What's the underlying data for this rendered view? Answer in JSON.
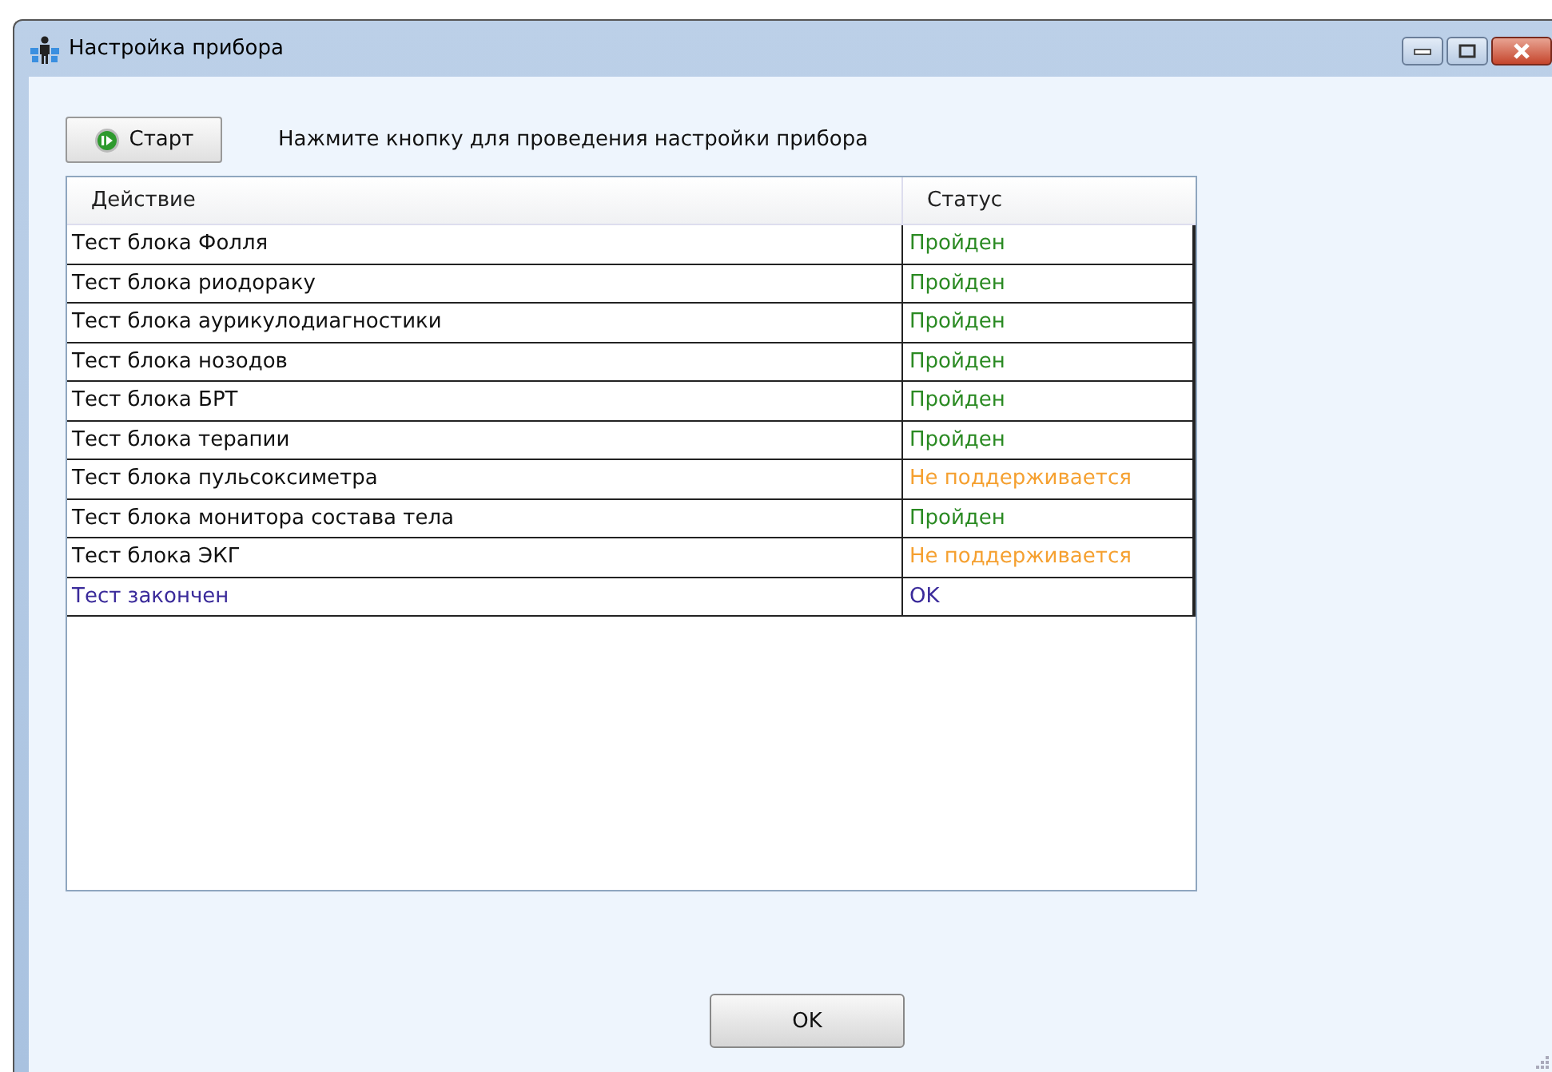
{
  "window": {
    "title": "Настройка прибора"
  },
  "start_button": {
    "label": "Старт"
  },
  "hint": "Нажмите кнопку для проведения настройки прибора",
  "table": {
    "columns": [
      "Действие",
      "Статус"
    ],
    "rows": [
      {
        "kind": "passed",
        "action": "Тест блока Фолля",
        "status": "Пройден"
      },
      {
        "kind": "passed",
        "action": "Тест блока риодораку",
        "status": "Пройден"
      },
      {
        "kind": "passed",
        "action": "Тест блока аурикулодиагностики",
        "status": "Пройден"
      },
      {
        "kind": "passed",
        "action": "Тест блока нозодов",
        "status": "Пройден"
      },
      {
        "kind": "passed",
        "action": "Тест блока БРТ",
        "status": "Пройден"
      },
      {
        "kind": "passed",
        "action": "Тест блока терапии",
        "status": "Пройден"
      },
      {
        "kind": "unsupported",
        "action": "Тест блока пульсоксиметра",
        "status": "Не поддерживается"
      },
      {
        "kind": "passed",
        "action": "Тест блока монитора состава тела",
        "status": "Пройден"
      },
      {
        "kind": "unsupported",
        "action": "Тест блока ЭКГ",
        "status": "Не поддерживается"
      },
      {
        "kind": "done",
        "action": "Тест закончен",
        "status": "OK"
      }
    ]
  },
  "ok_button": {
    "label": "OK"
  }
}
